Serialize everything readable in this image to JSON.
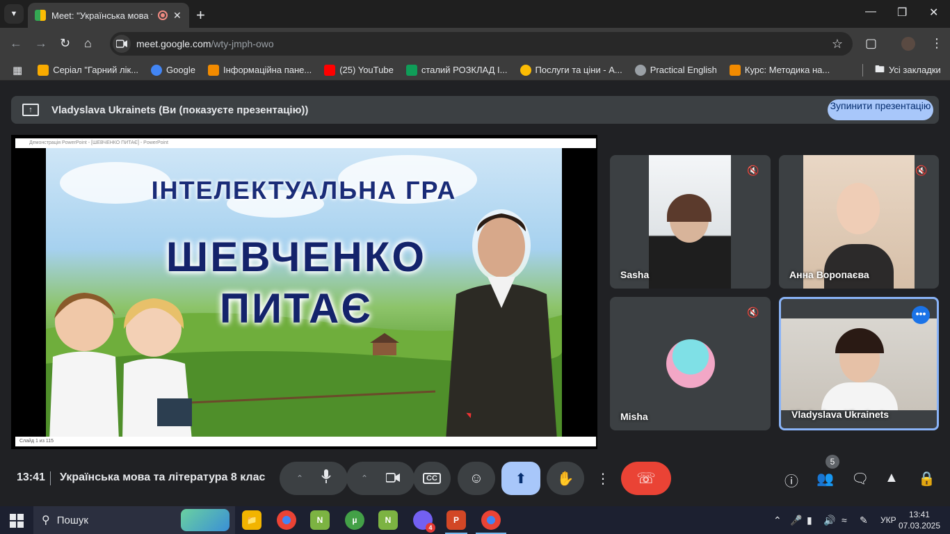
{
  "browser": {
    "tab_title": "Meet: \"Українська мова та",
    "url_host": "meet.google.com",
    "url_path": "/wty-jmph-owo"
  },
  "bookmarks": [
    {
      "label": "Серіал \"Гарний лік...",
      "color": "#f9ab00"
    },
    {
      "label": "Google",
      "color": "#4285f4"
    },
    {
      "label": "Інформаційна пане...",
      "color": "#f28b00"
    },
    {
      "label": "(25) YouTube",
      "color": "#ff0000"
    },
    {
      "label": "сталий РОЗКЛАД І...",
      "color": "#0f9d58"
    },
    {
      "label": "Послуги та ціни - А...",
      "color": "#fbbc04"
    },
    {
      "label": "Practical English",
      "color": "#9aa0a6"
    },
    {
      "label": "Курс: Методика на...",
      "color": "#f28b00"
    }
  ],
  "all_bookmarks": "Усі закладки",
  "presentation": {
    "presenter_text": "Vladyslava Ukrainets (Ви (показуєте презентацію))",
    "stop_button": "Зупинити презентацію",
    "window_title": "Демонстрація PowerPoint - [ШЕВЧЕНКО ПИТАЄ] - PowerPoint",
    "slide_status": "Слайд 1 из 115",
    "slide_heading": "ІНТЕЛЕКТУАЛЬНА ГРА",
    "slide_title_line1": "ШЕВЧЕНКО",
    "slide_title_line2": "ПИТАЄ"
  },
  "participants": [
    {
      "name": "Sasha",
      "muted": true
    },
    {
      "name": "Анна Воропаєва",
      "muted": true
    },
    {
      "name": "Misha",
      "muted": true
    },
    {
      "name": "Vladyslava Ukrainets",
      "muted": false
    }
  ],
  "meeting": {
    "time": "13:41",
    "name": "Українська мова та література 8 клас",
    "participant_count": "5"
  },
  "taskbar": {
    "search_label": "Пошук",
    "language": "УКР",
    "clock_time": "13:41",
    "clock_date": "07.03.2025",
    "viber_badge": "4"
  }
}
